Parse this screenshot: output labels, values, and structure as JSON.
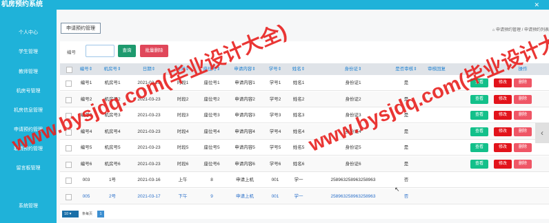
{
  "app": {
    "title": "机房预约系统",
    "close_glyph": "✕"
  },
  "sidebar": {
    "items": [
      "个人中心",
      "学生管理",
      "教师管理",
      "机房号管理",
      "机房信息管理",
      "申请预约管理",
      "取消预约管理",
      "留言板管理",
      "系统管理"
    ]
  },
  "header": {
    "section_button": "申请预约管理",
    "breadcrumb": "⌂ 申请预约管理 / 申请预约列表"
  },
  "search": {
    "label": "编号",
    "input_value": "",
    "query_button": "查询",
    "batch_delete_button": "批量删除"
  },
  "table": {
    "columns": [
      "编号",
      "机房号",
      "日期",
      "时间",
      "座位号",
      "申请内容",
      "学号",
      "姓名",
      "身份证",
      "是否审核",
      "审核回复",
      "操作"
    ],
    "sortable_indicator": "⇕",
    "rows": [
      [
        "编号1",
        "机房号1",
        "2021-03-23",
        "时段1",
        "座位号1",
        "申请内容1",
        "学号1",
        "姓名1",
        "身份证1",
        "是",
        ""
      ],
      [
        "编号2",
        "机房号2",
        "2021-03-23",
        "时段2",
        "座位号2",
        "申请内容2",
        "学号2",
        "姓名2",
        "身份证2",
        "是",
        ""
      ],
      [
        "编号3",
        "机房号3",
        "2021-03-23",
        "时段3",
        "座位号3",
        "申请内容3",
        "学号3",
        "姓名3",
        "身份证3",
        "是",
        ""
      ],
      [
        "编号4",
        "机房号4",
        "2021-03-23",
        "时段4",
        "座位号4",
        "申请内容4",
        "学号4",
        "姓名4",
        "身份证4",
        "是",
        ""
      ],
      [
        "编号5",
        "机房号5",
        "2021-03-23",
        "时段5",
        "座位号5",
        "申请内容5",
        "学号5",
        "姓名5",
        "身份证5",
        "是",
        ""
      ],
      [
        "编号6",
        "机房号6",
        "2021-03-23",
        "时段6",
        "座位号6",
        "申请内容6",
        "学号6",
        "姓名6",
        "身份证6",
        "是",
        ""
      ],
      [
        "003",
        "1号",
        "2021-03-16",
        "上午",
        "8",
        "申请上机",
        "001",
        "学一",
        "258963258963258963",
        "否",
        ""
      ],
      [
        "005",
        "2号",
        "2021-03-17",
        "下午",
        "9",
        "申请上机",
        "001",
        "学一",
        "258963258963258963",
        "否",
        ""
      ]
    ],
    "actions": {
      "view": "查看",
      "edit": "修改",
      "delete": "删除"
    }
  },
  "pagination": {
    "page_size": "10",
    "total_text": "条每页",
    "current_page": "1"
  },
  "watermark": {
    "line1": "www.bysjdq.com(毕业设计大全)",
    "line2": "www.bysjdq.com(毕业设计大全)"
  },
  "colors": {
    "primary": "#1fb2d9",
    "view": "#13c08a",
    "edit": "#e2131b",
    "delete": "#ef5666",
    "watermark": "#e8211f"
  }
}
